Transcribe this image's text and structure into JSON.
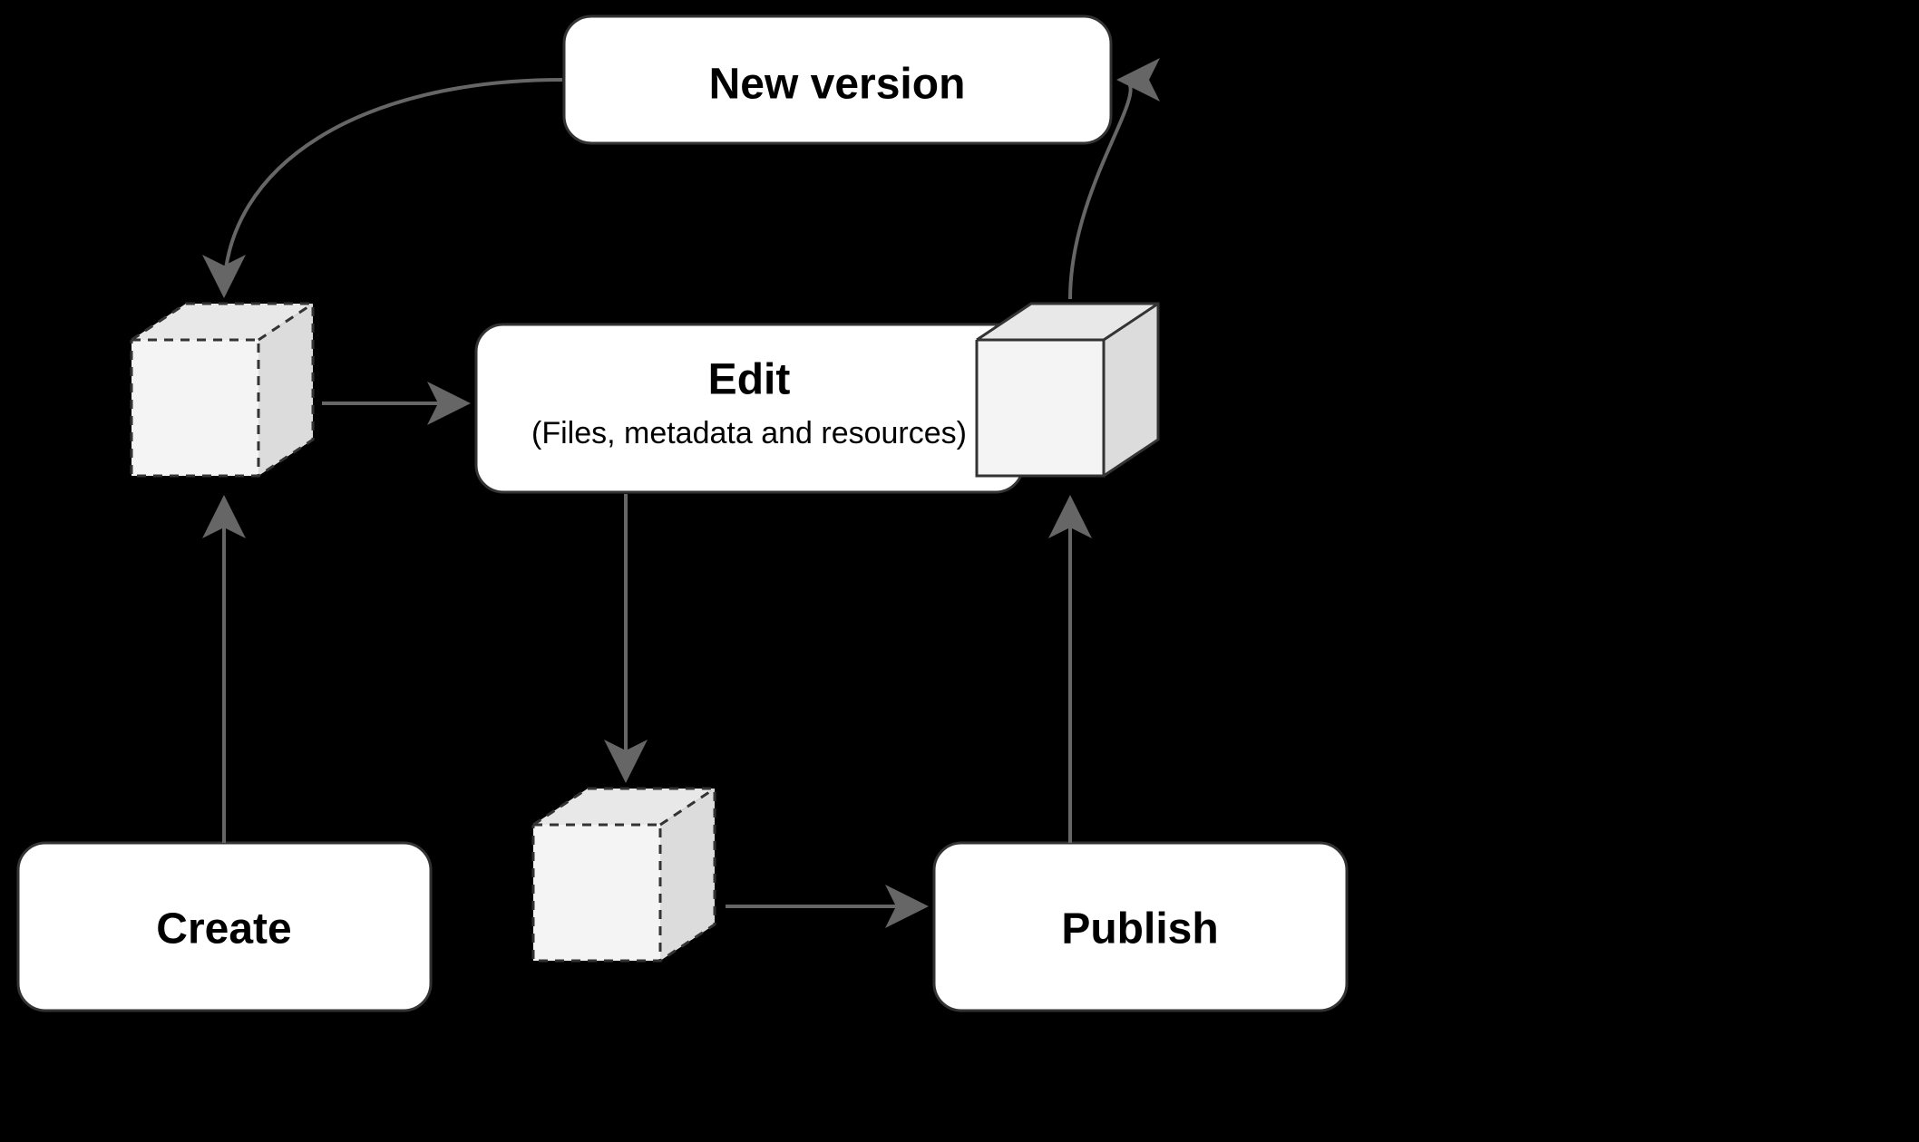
{
  "nodes": {
    "new_version": {
      "label": "New version"
    },
    "edit": {
      "label": "Edit",
      "sublabel": "(Files, metadata and resources)"
    },
    "create": {
      "label": "Create"
    },
    "publish": {
      "label": "Publish"
    }
  },
  "icons": {
    "draft_cube": "draft-cube (dashed)",
    "published_cube": "published-cube (solid)"
  },
  "flow_description": "Create → draft → Edit → draft → Publish → published → New version → draft (cycle back to Edit)"
}
